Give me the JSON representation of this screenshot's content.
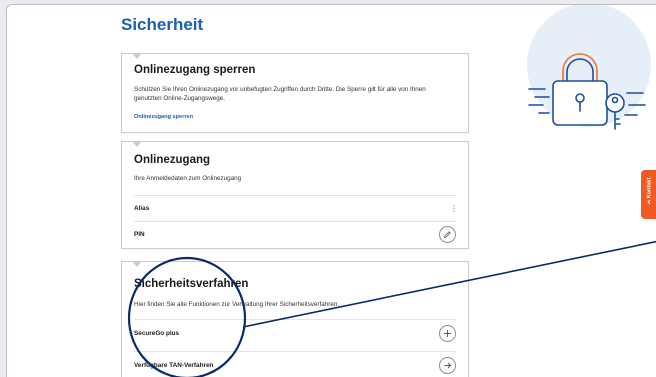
{
  "page": {
    "title": "Sicherheit"
  },
  "sperren": {
    "title": "Onlinezugang sperren",
    "description": "Schützen Sie Ihren Onlinezugang vor unbefugten Zugriffen durch Dritte. Die Sperre gilt für alle von Ihnen genutzten Online-Zugangswege.",
    "link": "Onlinezugang sperren"
  },
  "zugang": {
    "title": "Onlinezugang",
    "description": "Ihre Anmeldedaten zum Onlinezugang",
    "rows": [
      {
        "label": "Alias",
        "action": "more-icon"
      },
      {
        "label": "PIN",
        "action": "pencil-icon"
      }
    ]
  },
  "verfahren": {
    "title": "Sicherheitsverfahren",
    "description": "Hier finden Sie alle Funktionen zur Verwaltung Ihrer Sicherheitsverfahren.",
    "rows": [
      {
        "label": "SecureGo plus",
        "action": "plus-icon"
      },
      {
        "label": "Verfügbare TAN-Verfahren",
        "action": "arrow-right-icon"
      }
    ]
  },
  "kontakt": {
    "label": "Kontakt",
    "color": "#f15a22"
  },
  "colors": {
    "brand": "#1a5fb4",
    "annotation": "#0a2a6b",
    "illustration_bg": "#e6eef8"
  }
}
